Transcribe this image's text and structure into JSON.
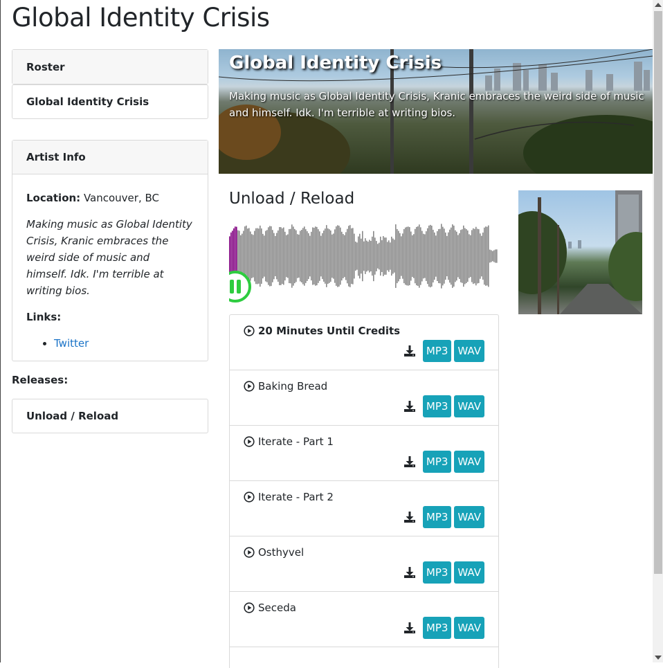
{
  "page": {
    "title": "Global Identity Crisis"
  },
  "sidebar": {
    "roster_label": "Roster",
    "artist_link": "Global Identity Crisis",
    "artist_info": {
      "heading": "Artist Info",
      "location_label": "Location:",
      "location_value": " Vancouver, BC",
      "bio": "Making music as Global Identity Crisis, Kranic embraces the weird side of music and himself. Idk. I'm terrible at writing bios.",
      "links_label": "Links:",
      "links": [
        "Twitter"
      ]
    },
    "releases_label": "Releases:",
    "releases": [
      "Unload / Reload"
    ]
  },
  "hero": {
    "title": "Global Identity Crisis",
    "bio": "Making music as Global Identity Crisis, Kranic embraces the weird side of music and himself. Idk. I'm terrible at writing bios."
  },
  "album": {
    "title": "Unload / Reload",
    "player": {
      "state": "playing",
      "progress": 0.03,
      "accent": "#2ecc40",
      "progress_color": "#800080",
      "wave_color": "#888888"
    }
  },
  "tracks": [
    {
      "name": "20 Minutes Until Credits",
      "active": true,
      "mp3": "MP3",
      "wav": "WAV"
    },
    {
      "name": "Baking Bread",
      "active": false,
      "mp3": "MP3",
      "wav": "WAV"
    },
    {
      "name": "Iterate - Part 1",
      "active": false,
      "mp3": "MP3",
      "wav": "WAV"
    },
    {
      "name": "Iterate - Part 2",
      "active": false,
      "mp3": "MP3",
      "wav": "WAV"
    },
    {
      "name": "Osthyvel",
      "active": false,
      "mp3": "MP3",
      "wav": "WAV"
    },
    {
      "name": "Seceda",
      "active": false,
      "mp3": "MP3",
      "wav": "WAV"
    }
  ],
  "colors": {
    "button": "#17a2b8",
    "link": "#1a73c7"
  }
}
